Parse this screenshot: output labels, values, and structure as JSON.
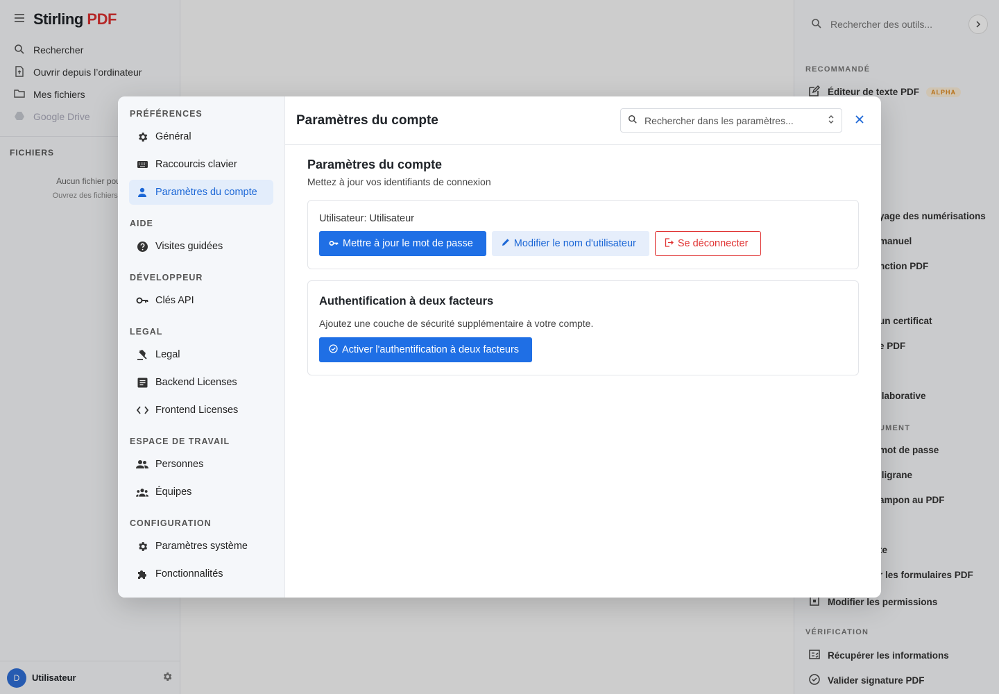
{
  "app": {
    "brand_name": "Stirling",
    "brand_suffix": "PDF",
    "left_nav": [
      {
        "label": "Rechercher",
        "icon": "search-icon"
      },
      {
        "label": "Ouvrir depuis l’ordinateur",
        "icon": "file-upload-icon"
      },
      {
        "label": "Mes fichiers",
        "icon": "folder-icon"
      },
      {
        "label": "Google Drive",
        "icon": "google-drive-icon",
        "disabled": true
      }
    ],
    "files_section": "FICHIERS",
    "empty_title": "Aucun fichier pour le r",
    "empty_sub": "Ouvrez des fichiers pour c",
    "user_initial": "D",
    "user_name": "Utilisateur",
    "tools_search_placeholder": "Rechercher des outils...",
    "tools_sections": [
      "RECOMMANDÉ",
      "VÉRIFICATION"
    ],
    "tool_recommended": "Éditeur de texte PDF",
    "tool_badge": "ALPHA",
    "tool_fragments": [
      "yage des numérisations",
      "manuel",
      "nction PDF",
      "un certificat",
      "e PDF",
      "llaborative",
      "UMENT",
      "mot de passe",
      "iligrane",
      "ampon au PDF",
      "te",
      "r les formulaires PDF"
    ],
    "tool_permissions": "Modifier les permissions",
    "tool_recover": "Récupérer les informations",
    "tool_validate": "Valider signature PDF"
  },
  "modal": {
    "sidebar": {
      "sections": [
        {
          "title": "PRÉFÉRENCES",
          "items": [
            {
              "label": "Général",
              "icon": "gear-icon"
            },
            {
              "label": "Raccourcis clavier",
              "icon": "keyboard-icon"
            },
            {
              "label": "Paramètres du compte",
              "icon": "person-icon",
              "active": true
            }
          ]
        },
        {
          "title": "AIDE",
          "items": [
            {
              "label": "Visites guidées",
              "icon": "help-icon"
            }
          ]
        },
        {
          "title": "DÉVELOPPEUR",
          "items": [
            {
              "label": "Clés API",
              "icon": "key-icon"
            }
          ]
        },
        {
          "title": "LEGAL",
          "items": [
            {
              "label": "Legal",
              "icon": "gavel-icon"
            },
            {
              "label": "Backend Licenses",
              "icon": "article-icon"
            },
            {
              "label": "Frontend Licenses",
              "icon": "code-icon"
            }
          ]
        },
        {
          "title": "ESPACE DE TRAVAIL",
          "items": [
            {
              "label": "Personnes",
              "icon": "people-icon"
            },
            {
              "label": "Équipes",
              "icon": "groups-icon"
            }
          ]
        },
        {
          "title": "CONFIGURATION",
          "items": [
            {
              "label": "Paramètres système",
              "icon": "gear-icon"
            },
            {
              "label": "Fonctionnalités",
              "icon": "puzzle-icon"
            }
          ]
        }
      ]
    },
    "header_title": "Paramètres du compte",
    "search_placeholder": "Rechercher dans les paramètres...",
    "body": {
      "title": "Paramètres du compte",
      "description": "Mettez à jour vos identifiants de connexion",
      "user_label": "Utilisateur: Utilisateur",
      "btn_update_password": "Mettre à jour le mot de passe",
      "btn_change_username": "Modifier le nom d'utilisateur",
      "btn_logout": "Se déconnecter",
      "twofa_title": "Authentification à deux facteurs",
      "twofa_description": "Ajoutez une couche de sécurité supplémentaire à votre compte.",
      "btn_enable_2fa": "Activer l'authentification à deux facteurs"
    },
    "colors": {
      "primary": "#1f6fe5",
      "active_bg": "#e3edfb",
      "danger": "#e03131"
    }
  }
}
